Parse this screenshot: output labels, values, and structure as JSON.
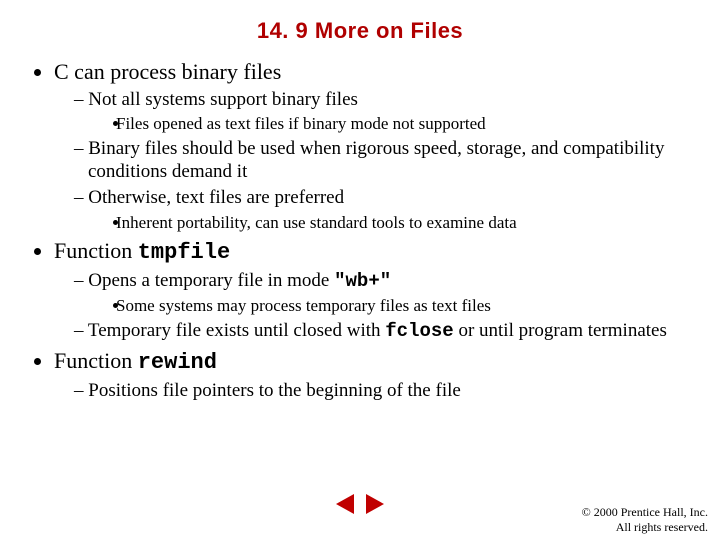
{
  "title": "14. 9  More on Files",
  "b1": {
    "text": "C can process binary files",
    "d1": "Not all systems support binary files",
    "d1_s1": "Files opened as text files if binary mode not supported",
    "d2": "Binary files should be used when rigorous speed, storage, and compatibility conditions demand it",
    "d3": "Otherwise, text files are preferred",
    "d3_s1": "Inherent portability, can use standard tools to examine data"
  },
  "b2": {
    "text_pre": "Function ",
    "text_code": "tmpfile",
    "d1_pre": "Opens a temporary file in mode ",
    "d1_code": "\"wb+\"",
    "d1_s1": "Some systems may process temporary files as text files",
    "d2_pre": "Temporary file exists until closed with ",
    "d2_code": "fclose",
    "d2_post": " or until program terminates"
  },
  "b3": {
    "text_pre": "Function ",
    "text_code": "rewind",
    "d1": "Positions file pointers to the beginning of the file"
  },
  "copyright": {
    "line1": "© 2000 Prentice Hall, Inc.",
    "line2": "All rights reserved."
  },
  "icons": {
    "prev": "previous",
    "next": "next"
  }
}
